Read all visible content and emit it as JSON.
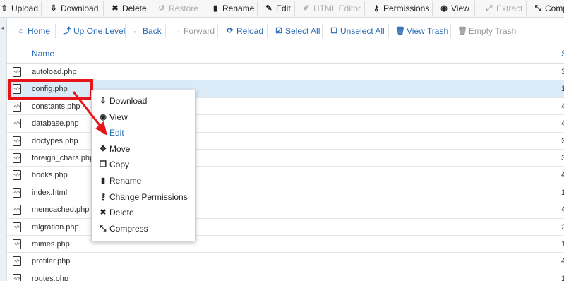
{
  "toolbar": {
    "items": [
      {
        "label": "Upload",
        "icon": "upload-icon"
      },
      {
        "label": "Download",
        "icon": "download-icon"
      },
      {
        "label": "Delete",
        "icon": "delete-icon"
      },
      {
        "label": "Restore",
        "icon": "restore-icon"
      },
      {
        "label": "Rename",
        "icon": "rename-icon"
      },
      {
        "label": "Edit",
        "icon": "edit-icon"
      },
      {
        "label": "HTML Editor",
        "icon": "html-editor-icon"
      },
      {
        "label": "Permissions",
        "icon": "key-icon"
      },
      {
        "label": "View",
        "icon": "eye-icon"
      },
      {
        "label": "Extract",
        "icon": "extract-icon"
      },
      {
        "label": "Comp",
        "icon": "compress-icon"
      }
    ]
  },
  "nav": {
    "items": [
      {
        "label": "Home",
        "icon": "home-icon"
      },
      {
        "label": "Up One Level",
        "icon": "level-up-icon"
      },
      {
        "label": "Back",
        "icon": "arrow-left-icon"
      },
      {
        "label": "Forward",
        "icon": "arrow-right-icon"
      },
      {
        "label": "Reload",
        "icon": "reload-icon"
      },
      {
        "label": "Select All",
        "icon": "checkbox-checked-icon"
      },
      {
        "label": "Unselect All",
        "icon": "checkbox-empty-icon"
      },
      {
        "label": "View Trash",
        "icon": "trash-icon"
      },
      {
        "label": "Empty Trash",
        "icon": "trash-icon"
      }
    ]
  },
  "table": {
    "columns": {
      "name": "Name",
      "size": "S"
    },
    "rows": [
      {
        "name": "autoload.php",
        "size": "3"
      },
      {
        "name": "config.php",
        "size": "1"
      },
      {
        "name": "constants.php",
        "size": "4"
      },
      {
        "name": "database.php",
        "size": "4"
      },
      {
        "name": "doctypes.php",
        "size": "2"
      },
      {
        "name": "foreign_chars.php",
        "size": "3"
      },
      {
        "name": "hooks.php",
        "size": "4"
      },
      {
        "name": "index.html",
        "size": "1"
      },
      {
        "name": "memcached.php",
        "size": "4"
      },
      {
        "name": "migration.php",
        "size": "2"
      },
      {
        "name": "mimes.php",
        "size": "1"
      },
      {
        "name": "profiler.php",
        "size": "4"
      },
      {
        "name": "routes.php",
        "size": "1"
      }
    ]
  },
  "context_menu": {
    "items": [
      {
        "label": "Download",
        "icon": "download-icon"
      },
      {
        "label": "View",
        "icon": "eye-icon"
      },
      {
        "label": "Edit",
        "icon": "pencil-icon"
      },
      {
        "label": "Move",
        "icon": "move-icon"
      },
      {
        "label": "Copy",
        "icon": "copy-icon"
      },
      {
        "label": "Rename",
        "icon": "file-icon"
      },
      {
        "label": "Change Permissions",
        "icon": "key-icon"
      },
      {
        "label": "Delete",
        "icon": "delete-icon"
      },
      {
        "label": "Compress",
        "icon": "compress-icon"
      }
    ]
  },
  "colors": {
    "link": "#2a6bb4",
    "selected_row": "#dbeaf7",
    "highlight": "#e8141a"
  }
}
